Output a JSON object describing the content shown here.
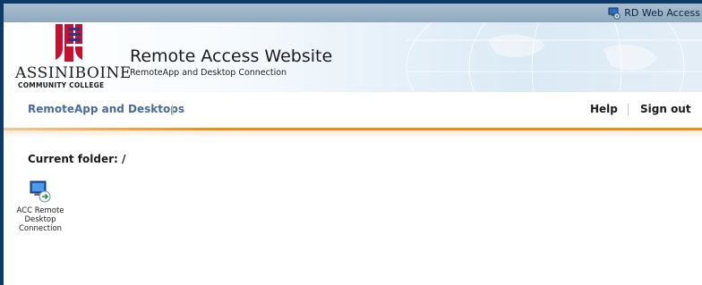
{
  "topbar": {
    "rd_web_label": "RD Web Access",
    "icon": "rd-web-access-icon"
  },
  "banner": {
    "logo": {
      "name": "ASSINIBOINE",
      "subtitle": "COMMUNITY COLLEGE"
    },
    "title": "Remote Access Website",
    "subtitle": "RemoteApp and Desktop Connection"
  },
  "nav": {
    "tab_label": "RemoteApp and Desktops",
    "help_label": "Help",
    "signout_label": "Sign out"
  },
  "content": {
    "folder_label": "Current folder: /",
    "apps": [
      {
        "label": "ACC Remote Desktop Connection",
        "icon": "remote-desktop-icon"
      }
    ]
  },
  "colors": {
    "frame_border": "#0d3b66",
    "topbar": "#9fb6ca",
    "nav_tab": "#4a6c94",
    "accent_orange": "#f08a1c",
    "logo_red": "#c8102e",
    "logo_blue": "#1f3a93"
  }
}
